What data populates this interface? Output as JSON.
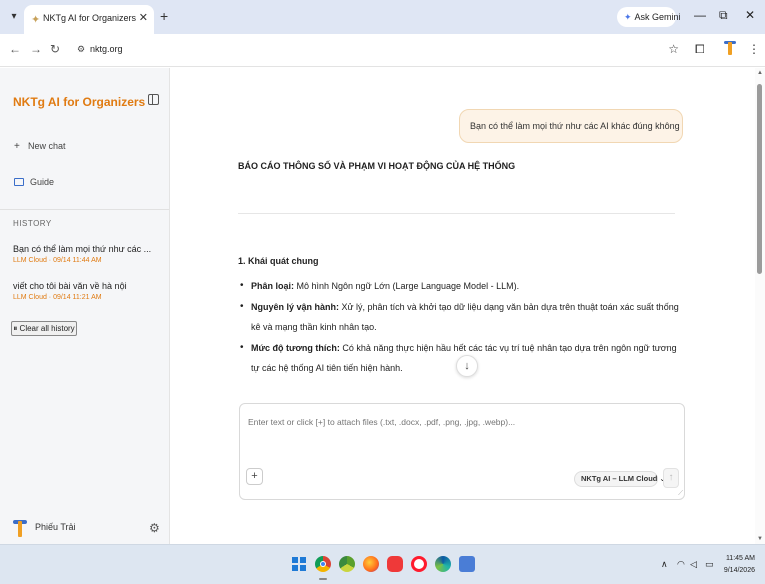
{
  "browser": {
    "tab_title": "NKTg AI for Organizers",
    "tab_close": "✕",
    "new_tab": "+",
    "gemini_label": "Ask Gemini",
    "url": "nktg.org",
    "icons": [
      "back-icon",
      "forward-icon",
      "reload-icon",
      "site-settings-icon",
      "star-icon",
      "extensions-icon",
      "profile-icon",
      "menu-icon"
    ]
  },
  "sidebar": {
    "brand": "NKTg AI for Organizers",
    "new_chat": "New chat",
    "guide": "Guide",
    "history_label": "HISTORY",
    "history": [
      {
        "title": "Bạn có thể làm mọi thứ như các ...",
        "meta": "LLM Cloud · 09/14 11:44 AM"
      },
      {
        "title": "viết cho tôi bài văn về hà nội",
        "meta": "LLM Cloud · 09/14 11:21 AM"
      }
    ],
    "clear_history": "Clear all history",
    "user_name": "Phiếu Trải"
  },
  "chat": {
    "user_message": "Bạn có thể làm mọi thứ như các AI khác đúng không",
    "report_title": "BÁO CÁO THÔNG SỐ VÀ PHẠM VI HOẠT ĐỘNG CỦA HỆ THỐNG",
    "section_title": "1. Khái quát chung",
    "bullets": [
      {
        "label": "Phân loại:",
        "text": " Mô hình Ngôn ngữ Lớn (Large Language Model - LLM)."
      },
      {
        "label": "Nguyên lý vận hành:",
        "text": " Xử lý, phân tích và khởi tạo dữ liệu dạng văn bản dựa trên thuật toán xác suất thống kê và mạng thần kinh nhân tạo."
      },
      {
        "label": "Mức độ tương thích:",
        "text": " Có khả năng thực hiện hầu hết các tác vụ trí tuệ nhân tạo dựa trên ngôn ngữ tương tự các hệ thống AI tiên tiến hiện hành."
      }
    ],
    "scroll_down": "↓"
  },
  "composer": {
    "placeholder": "Enter text or click [+] to attach files (.txt, .docx, .pdf, .png, .jpg, .webp)...",
    "attach": "+",
    "model": "NKTg AI – LLM Cloud",
    "send": "↑"
  },
  "taskbar": {
    "time": "11:45 AM",
    "date": "9/14/2026"
  },
  "colors": {
    "accent": "#e07b12",
    "bubble": "#fdf3e7",
    "tabbar": "#dfe6f4"
  }
}
